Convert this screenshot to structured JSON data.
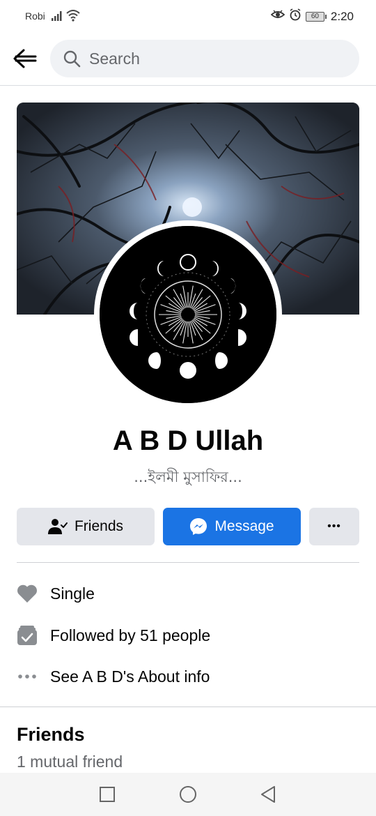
{
  "status_bar": {
    "carrier": "Robi",
    "battery": "60",
    "time": "2:20"
  },
  "search": {
    "placeholder": "Search"
  },
  "profile": {
    "name": "A B D Ullah",
    "bio": "...ইলমী মুসাফির..."
  },
  "actions": {
    "friends_label": "Friends",
    "message_label": "Message",
    "more_label": "•••"
  },
  "info": {
    "relationship": "Single",
    "followers": "Followed by 51 people",
    "about": "See A B D's About info"
  },
  "friends_section": {
    "title": "Friends",
    "subtitle": "1 mutual friend"
  },
  "colors": {
    "accent": "#1b74e4",
    "secondary_button": "#e4e6eb",
    "muted_text": "#65676b"
  }
}
